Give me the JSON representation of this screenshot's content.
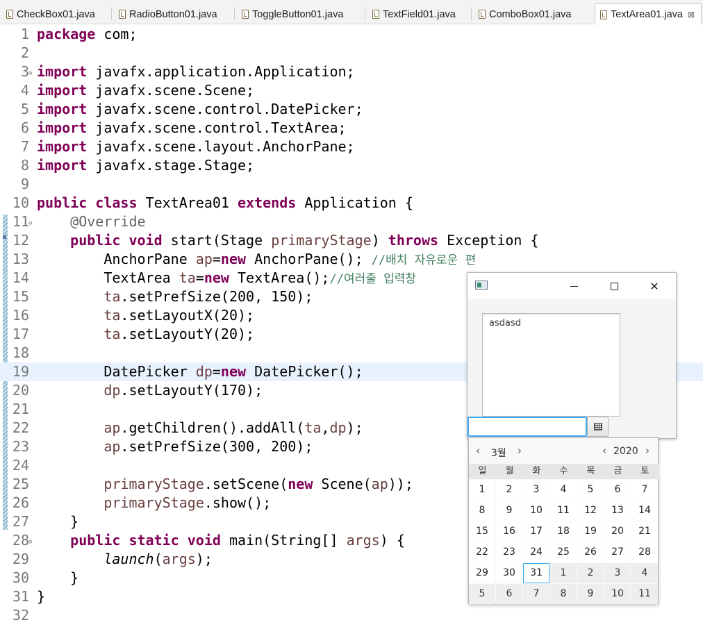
{
  "tabs": [
    {
      "label": "CheckBox01.java",
      "active": false
    },
    {
      "label": "RadioButton01.java",
      "active": false
    },
    {
      "label": "ToggleButton01.java",
      "active": false
    },
    {
      "label": "TextField01.java",
      "active": false
    },
    {
      "label": "ComboBox01.java",
      "active": false
    },
    {
      "label": "TextArea01.java",
      "active": true
    }
  ],
  "editor": {
    "current_line": 19,
    "lines": [
      {
        "n": "1",
        "code": "<span class=\"kw\">package</span> com;"
      },
      {
        "n": "2",
        "code": ""
      },
      {
        "n": "3",
        "fold": true,
        "code": "<span class=\"kw\">import</span> javafx.application.Application;"
      },
      {
        "n": "4",
        "code": "<span class=\"kw\">import</span> javafx.scene.Scene;"
      },
      {
        "n": "5",
        "code": "<span class=\"kw\">import</span> javafx.scene.control.DatePicker;"
      },
      {
        "n": "6",
        "code": "<span class=\"kw\">import</span> javafx.scene.control.TextArea;"
      },
      {
        "n": "7",
        "code": "<span class=\"kw\">import</span> javafx.scene.layout.AnchorPane;"
      },
      {
        "n": "8",
        "code": "<span class=\"kw\">import</span> javafx.stage.Stage;"
      },
      {
        "n": "9",
        "code": ""
      },
      {
        "n": "10",
        "code": "<span class=\"kw\">public</span> <span class=\"kw\">class</span> TextArea01 <span class=\"kw\">extends</span> Application {"
      },
      {
        "n": "11",
        "fold": true,
        "code": "    <span class=\"ann\">@Override</span>"
      },
      {
        "n": "12",
        "code": "    <span class=\"kw\">public</span> <span class=\"kw\">void</span> start(Stage <span class=\"var\">primaryStage</span>) <span class=\"kw\">throws</span> Exception {"
      },
      {
        "n": "13",
        "code": "        AnchorPane <span class=\"var\">ap</span>=<span class=\"kw\">new</span> AnchorPane(); <span class=\"cmt\">//배치 자유로운 편</span>"
      },
      {
        "n": "14",
        "code": "        TextArea <span class=\"var\">ta</span>=<span class=\"kw\">new</span> TextArea();<span class=\"cmt\">//여러줄 입력창</span>"
      },
      {
        "n": "15",
        "code": "        <span class=\"var\">ta</span>.setPrefSize(200, 150);"
      },
      {
        "n": "16",
        "code": "        <span class=\"var\">ta</span>.setLayoutX(20);"
      },
      {
        "n": "17",
        "code": "        <span class=\"var\">ta</span>.setLayoutY(20);"
      },
      {
        "n": "18",
        "code": ""
      },
      {
        "n": "19",
        "code": "        DatePicker <span class=\"var\">dp</span>=<span class=\"kw\">new</span> DatePicker();"
      },
      {
        "n": "20",
        "code": "        <span class=\"var\">dp</span>.setLayoutY(170);"
      },
      {
        "n": "21",
        "code": ""
      },
      {
        "n": "22",
        "code": "        <span class=\"var\">ap</span>.getChildren().addAll(<span class=\"var\">ta</span>,<span class=\"var\">dp</span>);"
      },
      {
        "n": "23",
        "code": "        <span class=\"var\">ap</span>.setPrefSize(300, 200);"
      },
      {
        "n": "24",
        "code": ""
      },
      {
        "n": "25",
        "code": "        <span class=\"var\">primaryStage</span>.setScene(<span class=\"kw\">new</span> Scene(<span class=\"var\">ap</span>));"
      },
      {
        "n": "26",
        "code": "        <span class=\"var\">primaryStage</span>.show();"
      },
      {
        "n": "27",
        "code": "    }"
      },
      {
        "n": "28",
        "fold": true,
        "code": "    <span class=\"kw\">public</span> <span class=\"kw\">static</span> <span class=\"kw\">void</span> main(String[] <span class=\"var\">args</span>) {"
      },
      {
        "n": "29",
        "code": "        <span class=\"ital\">launch</span>(<span class=\"var\">args</span>);"
      },
      {
        "n": "30",
        "code": "    }"
      },
      {
        "n": "31",
        "code": "}"
      },
      {
        "n": "32",
        "code": ""
      }
    ]
  },
  "fx_window": {
    "icon": "app-window-icon",
    "textarea_value": "asdasd",
    "datepicker_value": "",
    "calendar_button_icon": "calendar-icon"
  },
  "calendar": {
    "month": "3월",
    "year": "2020",
    "weekdays": [
      "일",
      "월",
      "화",
      "수",
      "목",
      "금",
      "토"
    ],
    "today": "31",
    "weeks": [
      [
        "1",
        "2",
        "3",
        "4",
        "5",
        "6",
        "7"
      ],
      [
        "8",
        "9",
        "10",
        "11",
        "12",
        "13",
        "14"
      ],
      [
        "15",
        "16",
        "17",
        "18",
        "19",
        "20",
        "21"
      ],
      [
        "22",
        "23",
        "24",
        "25",
        "26",
        "27",
        "28"
      ],
      [
        "29",
        "30",
        "31",
        "1",
        "2",
        "3",
        "4"
      ],
      [
        "5",
        "6",
        "7",
        "8",
        "9",
        "10",
        "11"
      ]
    ],
    "other_month_cells": [
      [
        4,
        3
      ],
      [
        4,
        4
      ],
      [
        4,
        5
      ],
      [
        4,
        6
      ],
      [
        5,
        0
      ],
      [
        5,
        1
      ],
      [
        5,
        2
      ],
      [
        5,
        3
      ],
      [
        5,
        4
      ],
      [
        5,
        5
      ],
      [
        5,
        6
      ]
    ],
    "prev_symbol": "‹",
    "next_symbol": "›"
  },
  "window_buttons": {
    "close_symbol": "✕"
  }
}
